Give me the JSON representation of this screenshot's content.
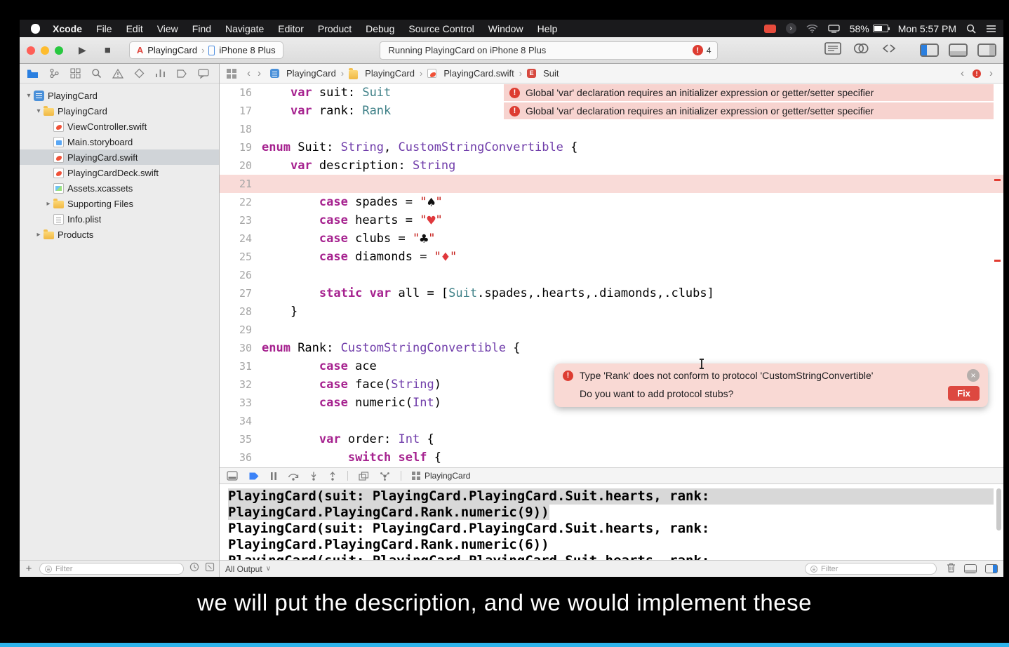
{
  "icons": {
    "disclosure_open": "▾",
    "disclosure_closed": "▸",
    "crumb_sep": "›",
    "error_mark": "!",
    "close_mark": "×",
    "enum_letter": "E",
    "back": "‹",
    "forward": "›",
    "output_caret": "∨",
    "plus": "+",
    "play": "▶",
    "stop": "■",
    "circle_arrow": "›"
  },
  "menu_bar": {
    "items": [
      "Xcode",
      "File",
      "Edit",
      "View",
      "Find",
      "Navigate",
      "Editor",
      "Product",
      "Debug",
      "Source Control",
      "Window",
      "Help"
    ],
    "battery": "58%",
    "clock": "Mon 5:57 PM"
  },
  "toolbar": {
    "scheme": "PlayingCard",
    "device": "iPhone 8 Plus",
    "status": "Running PlayingCard on iPhone 8 Plus",
    "error_count": "4"
  },
  "navigator": {
    "filter_placeholder": "Filter",
    "tree": [
      {
        "label": "PlayingCard",
        "depth": 0,
        "icon": "project",
        "disclosure": "open"
      },
      {
        "label": "PlayingCard",
        "depth": 1,
        "icon": "folder",
        "disclosure": "open"
      },
      {
        "label": "ViewController.swift",
        "depth": 2,
        "icon": "swift"
      },
      {
        "label": "Main.storyboard",
        "depth": 2,
        "icon": "storyboard"
      },
      {
        "label": "PlayingCard.swift",
        "depth": 2,
        "icon": "swift",
        "selected": true
      },
      {
        "label": "PlayingCardDeck.swift",
        "depth": 2,
        "icon": "swift"
      },
      {
        "label": "Assets.xcassets",
        "depth": 2,
        "icon": "assets"
      },
      {
        "label": "Supporting Files",
        "depth": 2,
        "icon": "folder",
        "disclosure": "closed"
      },
      {
        "label": "Info.plist",
        "depth": 2,
        "icon": "plist"
      },
      {
        "label": "Products",
        "depth": 1,
        "icon": "folder",
        "disclosure": "closed"
      }
    ]
  },
  "jump_bar": {
    "crumbs": [
      "PlayingCard",
      "PlayingCard",
      "PlayingCard.swift",
      "Suit"
    ]
  },
  "editor": {
    "error_banner_text": "Global 'var' declaration requires an initializer expression or getter/setter specifier",
    "popup": {
      "line1": "Type 'Rank' does not conform to protocol 'CustomStringConvertible'",
      "line2": "Do you want to add protocol stubs?",
      "fix_label": "Fix"
    },
    "lines": [
      {
        "num": 16,
        "banner": true,
        "seg": [
          [
            "p",
            "    "
          ],
          [
            "k",
            "var"
          ],
          [
            "p",
            " suit: "
          ],
          [
            "g",
            "Suit"
          ]
        ]
      },
      {
        "num": 17,
        "banner": true,
        "seg": [
          [
            "p",
            "    "
          ],
          [
            "k",
            "var"
          ],
          [
            "p",
            " rank: "
          ],
          [
            "g",
            "Rank"
          ]
        ]
      },
      {
        "num": 18,
        "seg": []
      },
      {
        "num": 19,
        "seg": [
          [
            "k",
            "enum"
          ],
          [
            "p",
            " Suit: "
          ],
          [
            "t",
            "String"
          ],
          [
            "p",
            ", "
          ],
          [
            "t",
            "CustomStringConvertible"
          ],
          [
            "p",
            " {"
          ]
        ]
      },
      {
        "num": 20,
        "seg": [
          [
            "p",
            "    "
          ],
          [
            "k",
            "var"
          ],
          [
            "p",
            " description: "
          ],
          [
            "t",
            "String"
          ]
        ]
      },
      {
        "num": 21,
        "tint": true,
        "seg": []
      },
      {
        "num": 22,
        "seg": [
          [
            "p",
            "        "
          ],
          [
            "k",
            "case"
          ],
          [
            "p",
            " spades = "
          ],
          [
            "s",
            "\""
          ],
          [
            "b",
            "♠"
          ],
          [
            "s",
            "\""
          ]
        ]
      },
      {
        "num": 23,
        "seg": [
          [
            "p",
            "        "
          ],
          [
            "k",
            "case"
          ],
          [
            "p",
            " hearts = "
          ],
          [
            "s",
            "\""
          ],
          [
            "r",
            "♥"
          ],
          [
            "s",
            "\""
          ]
        ]
      },
      {
        "num": 24,
        "seg": [
          [
            "p",
            "        "
          ],
          [
            "k",
            "case"
          ],
          [
            "p",
            " clubs = "
          ],
          [
            "s",
            "\""
          ],
          [
            "b",
            "♣"
          ],
          [
            "s",
            "\""
          ]
        ]
      },
      {
        "num": 25,
        "seg": [
          [
            "p",
            "        "
          ],
          [
            "k",
            "case"
          ],
          [
            "p",
            " diamonds = "
          ],
          [
            "s",
            "\""
          ],
          [
            "r",
            "♦"
          ],
          [
            "s",
            "\""
          ]
        ]
      },
      {
        "num": 26,
        "seg": []
      },
      {
        "num": 27,
        "seg": [
          [
            "p",
            "        "
          ],
          [
            "k",
            "static"
          ],
          [
            "p",
            " "
          ],
          [
            "k",
            "var"
          ],
          [
            "p",
            " all = ["
          ],
          [
            "g",
            "Suit"
          ],
          [
            "p",
            ".spades,.hearts,.diamonds,.clubs]"
          ]
        ]
      },
      {
        "num": 28,
        "seg": [
          [
            "p",
            "    }"
          ]
        ]
      },
      {
        "num": 29,
        "seg": []
      },
      {
        "num": 30,
        "seg": [
          [
            "k",
            "enum"
          ],
          [
            "p",
            " Rank: "
          ],
          [
            "t",
            "CustomStringConvertible"
          ],
          [
            "p",
            " {"
          ]
        ]
      },
      {
        "num": 31,
        "seg": [
          [
            "p",
            "        "
          ],
          [
            "k",
            "case"
          ],
          [
            "p",
            " ace"
          ]
        ]
      },
      {
        "num": 32,
        "seg": [
          [
            "p",
            "        "
          ],
          [
            "k",
            "case"
          ],
          [
            "p",
            " face("
          ],
          [
            "t",
            "String"
          ],
          [
            "p",
            ")"
          ]
        ]
      },
      {
        "num": 33,
        "seg": [
          [
            "p",
            "        "
          ],
          [
            "k",
            "case"
          ],
          [
            "p",
            " numeric("
          ],
          [
            "t",
            "Int"
          ],
          [
            "p",
            ")"
          ]
        ]
      },
      {
        "num": 34,
        "seg": []
      },
      {
        "num": 35,
        "seg": [
          [
            "p",
            "        "
          ],
          [
            "k",
            "var"
          ],
          [
            "p",
            " order: "
          ],
          [
            "t",
            "Int"
          ],
          [
            "p",
            " {"
          ]
        ]
      },
      {
        "num": 36,
        "seg": [
          [
            "p",
            "            "
          ],
          [
            "k",
            "switch"
          ],
          [
            "p",
            " "
          ],
          [
            "k",
            "self"
          ],
          [
            "p",
            " {"
          ]
        ]
      }
    ]
  },
  "debug_bar": {
    "target": "PlayingCard"
  },
  "console": {
    "filter_label": "All Output",
    "filter_placeholder": "Filter",
    "lines": [
      {
        "text": "PlayingCard(suit: PlayingCard.PlayingCard.Suit.hearts, rank:",
        "selected": true,
        "full": true
      },
      {
        "text": "PlayingCard.PlayingCard.Rank.numeric(9))",
        "selected": true
      },
      {
        "text": "PlayingCard(suit: PlayingCard.PlayingCard.Suit.hearts, rank:"
      },
      {
        "text": "PlayingCard.PlayingCard.Rank.numeric(6))"
      },
      {
        "text": "PlayingCard(suit: PlayingCard.PlayingCard.Suit.hearts, rank:",
        "partial": true
      }
    ]
  },
  "caption": "we will put the description, and we would implement these"
}
